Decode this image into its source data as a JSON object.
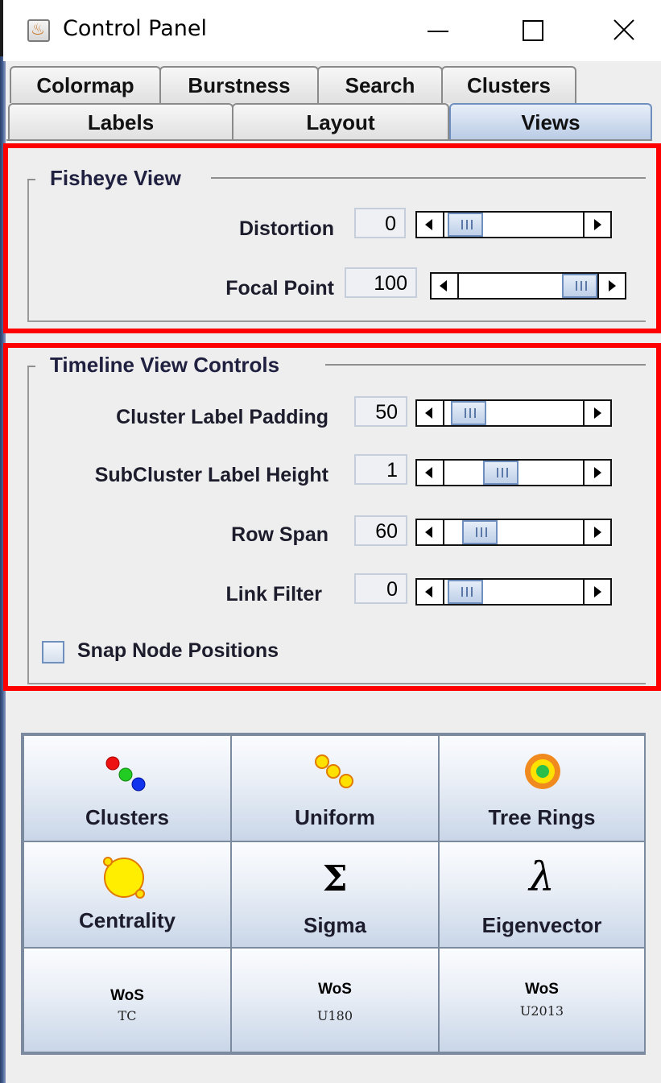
{
  "window": {
    "title": "Control Panel",
    "app_icon": "java-cup-icon",
    "controls": [
      "minimize-icon",
      "maximize-icon",
      "close-icon"
    ]
  },
  "tabs": {
    "row1": [
      "Colormap",
      "Burstness",
      "Search",
      "Clusters"
    ],
    "row2": [
      "Labels",
      "Layout",
      "Views"
    ],
    "selected": "Views"
  },
  "fisheye": {
    "title": "Fisheye View",
    "rows": [
      {
        "label": "Distortion",
        "value": "0",
        "slider_fraction": 0.0
      },
      {
        "label": "Focal Point",
        "value": "100",
        "slider_fraction": 1.0
      }
    ]
  },
  "timeline": {
    "title": "Timeline View Controls",
    "rows": [
      {
        "label": "Cluster Label Padding",
        "value": "50",
        "slider_fraction": 0.02
      },
      {
        "label": "SubCluster Label Height",
        "value": "1",
        "slider_fraction": 0.3
      },
      {
        "label": "Row Span",
        "value": "60",
        "slider_fraction": 0.1
      },
      {
        "label": "Link Filter",
        "value": "0",
        "slider_fraction": 0.0
      }
    ],
    "snap_label": "Snap Node Positions",
    "snap_checked": false
  },
  "buttons": [
    {
      "label": "Clusters",
      "icon": "clusters-dots-icon"
    },
    {
      "label": "Uniform",
      "icon": "uniform-dots-icon"
    },
    {
      "label": "Tree Rings",
      "icon": "tree-rings-icon"
    },
    {
      "label": "Centrality",
      "icon": "centrality-circle-icon"
    },
    {
      "label": "Sigma",
      "icon": "sigma-icon",
      "glyph": "Σ"
    },
    {
      "label": "Eigenvector",
      "icon": "lambda-icon",
      "glyph": "λ"
    },
    {
      "label": "WoS",
      "sub": "TC"
    },
    {
      "label": "WoS",
      "sub": "U180"
    },
    {
      "label": "WoS",
      "sub": "U2013"
    }
  ],
  "colors": {
    "highlight": "#ff0000",
    "selected_tab": "#b9cbe5"
  }
}
